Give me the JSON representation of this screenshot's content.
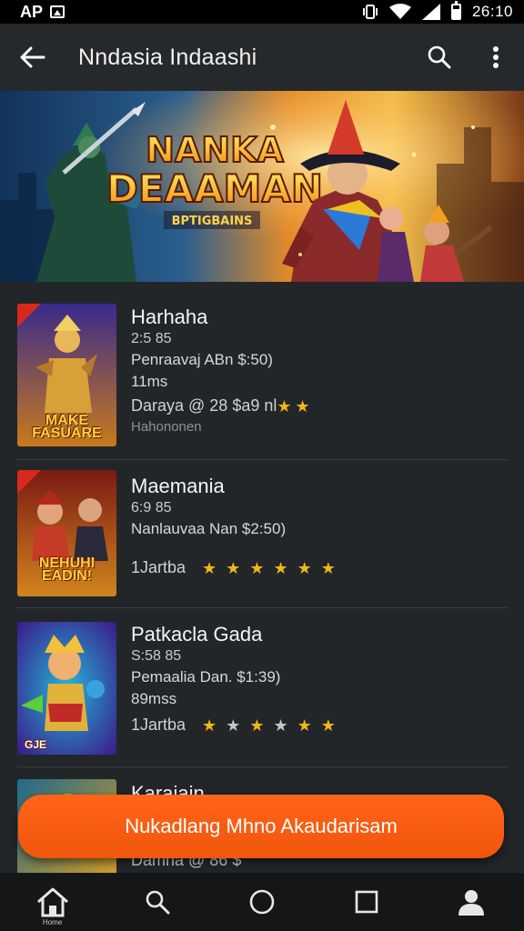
{
  "status_bar": {
    "left_text": "AP",
    "time": "26:10"
  },
  "app_bar": {
    "title": "Nndasia Indaashi"
  },
  "hero": {
    "title_line1": "NANKA",
    "title_line2": "DEAAMAN",
    "subtitle": "BPTIGBAINS"
  },
  "games": [
    {
      "title": "Harhaha",
      "line1": "2:5 85",
      "price": "Penraavaj ABn $:50)",
      "line3": "11ms",
      "rating_label": "Daraya  @ 28 $a9 nl",
      "stars": [
        "gold",
        "gold"
      ],
      "developer": "Hahononen",
      "thumb_caption": "MAKE FASUARE",
      "colors": {
        "bg1": "#3a2a8c",
        "bg2": "#c97a1c",
        "char": "#d9a03a"
      }
    },
    {
      "title": "Maemania",
      "line1": "6:9 85",
      "price": "Nanlauvaa Nan $2:50)",
      "rating_label": "1Jartba",
      "stars": [
        "gold",
        "gold",
        "gold",
        "gold",
        "gold",
        "gold"
      ],
      "thumb_caption": "NEHUHI EADIN!",
      "colors": {
        "bg1": "#7a1a12",
        "bg2": "#d2841e",
        "char": "#c63a28"
      }
    },
    {
      "title": "Patkacla Gada",
      "line1": "S:58 85",
      "price": "Pemaalia Dan. $1:39)",
      "line3": "89mss",
      "rating_label": "1Jartba",
      "stars": [
        "gold",
        "grey",
        "gold",
        "grey",
        "gold",
        "gold"
      ],
      "thumb_caption": "GJE",
      "colors": {
        "bg1": "#3b1a8a",
        "bg2": "#22b7d6",
        "char": "#e0b23a"
      }
    },
    {
      "title": "Karaiain",
      "line1": "",
      "price": "",
      "rating_label": "Damna  @ 86 $",
      "stars": [],
      "thumb_caption": "",
      "colors": {
        "bg1": "#1f6a8a",
        "bg2": "#e0a020",
        "char": "#8ad040"
      }
    }
  ],
  "cta": {
    "label": "Nukadlang Mhno Akaudarisam"
  },
  "bottom_nav": {
    "home_label": "Home"
  },
  "theme": {
    "accent": "#f25a0f",
    "background": "#232629",
    "star_gold": "#f1b61a"
  }
}
